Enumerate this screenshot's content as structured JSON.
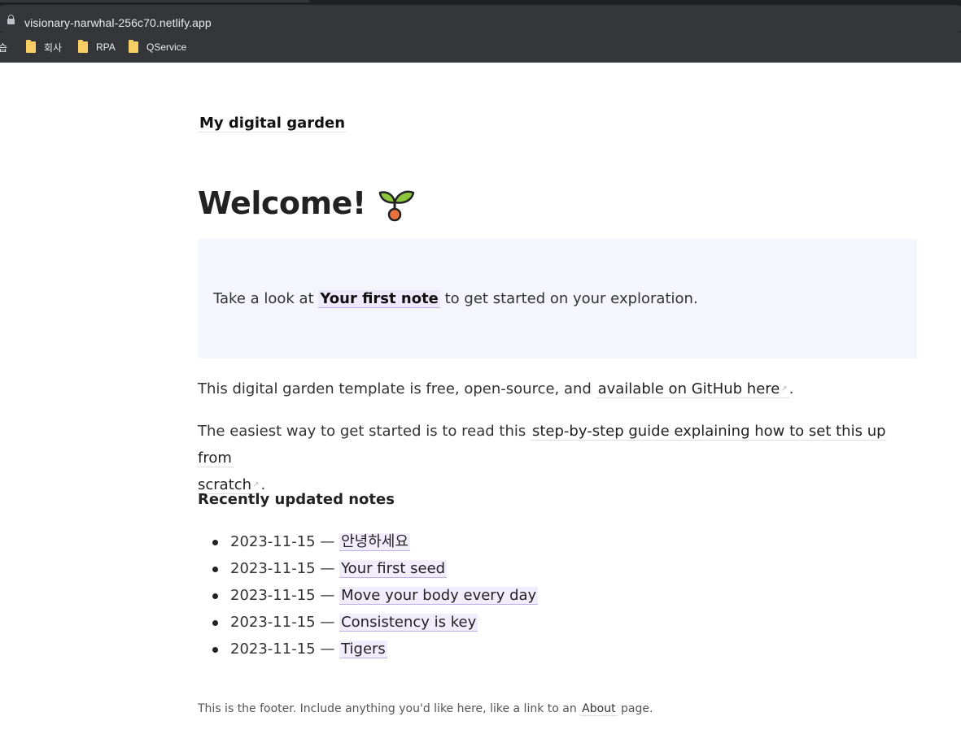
{
  "browser": {
    "url": "visionary-narwhal-256c70.netlify.app",
    "bookmarks": [
      {
        "label": "습"
      },
      {
        "label": "회사"
      },
      {
        "label": "RPA"
      },
      {
        "label": "QService"
      }
    ]
  },
  "site": {
    "title": "My digital garden"
  },
  "page": {
    "heading": "Welcome!",
    "callout": {
      "before": "Take a look at",
      "link": "Your first note",
      "after": "to get started on your exploration."
    },
    "para1": {
      "before": "This digital garden template is free, open-source, and",
      "link": "available on GitHub here",
      "after": "."
    },
    "para2": {
      "before": "The easiest way to get started is to read this",
      "link_line1": "step-by-step guide explaining how to set this up from",
      "link_line2": "scratch",
      "after": "."
    },
    "recent_heading": "Recently updated notes",
    "notes": [
      {
        "date": "2023-11-15",
        "title": "안녕하세요"
      },
      {
        "date": "2023-11-15",
        "title": "Your first seed"
      },
      {
        "date": "2023-11-15",
        "title": "Move your body every day"
      },
      {
        "date": "2023-11-15",
        "title": "Consistency is key"
      },
      {
        "date": "2023-11-15",
        "title": "Tigers"
      }
    ],
    "separator": "—",
    "external_arrow": "↗"
  },
  "footer": {
    "before": "This is the footer. Include anything you'd like here, like a link to an",
    "link": "About",
    "after": "page."
  },
  "colors": {
    "callout_bg": "#f4f5fd",
    "link_highlight": "#eeeafc",
    "browser_dark": "#202124"
  }
}
